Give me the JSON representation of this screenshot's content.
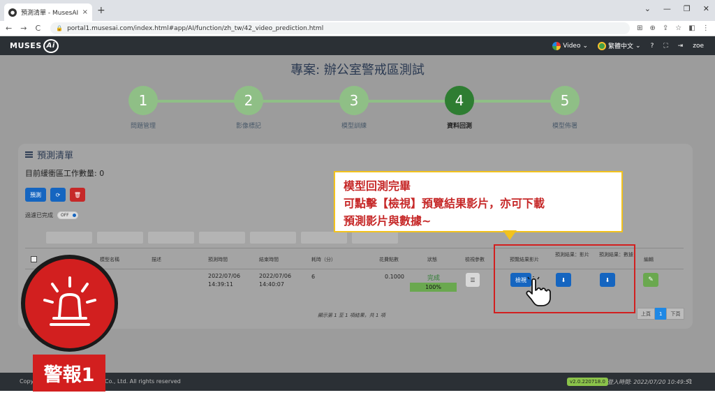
{
  "browser": {
    "tab_title": "預測清單 - MusesAI",
    "tab_close": "×",
    "new_tab": "+",
    "url": "portal1.musesai.com/index.html#app/AI/function/zh_tw/42_video_prediction.html",
    "win_controls": [
      "⌄",
      "—",
      "❐",
      "✕"
    ]
  },
  "header": {
    "logo_text": "MUSES",
    "logo_ai": "Ai",
    "video_label": "Video",
    "lang_label": "繁體中文",
    "user": "zoe"
  },
  "project": {
    "title": "專案: 辦公室警戒區測試"
  },
  "steps": [
    {
      "num": "1",
      "label": "問題管理"
    },
    {
      "num": "2",
      "label": "影像標記"
    },
    {
      "num": "3",
      "label": "模型訓練"
    },
    {
      "num": "4",
      "label": "資料回測"
    },
    {
      "num": "5",
      "label": "模型佈署"
    }
  ],
  "panel": {
    "title": "預測清單",
    "queue_text": "目前緩衝區工作數量: 0",
    "predict_btn": "預測",
    "refresh_icon": "⟳",
    "delete_icon": "🗑",
    "filter_label": "過濾已完成",
    "toggle_text": "OFF"
  },
  "table": {
    "headers": {
      "model_name": "模型名稱",
      "desc": "描述",
      "pred_time": "預測時間",
      "end_time": "結束時間",
      "duration": "耗時（分）",
      "points": "花費點數",
      "status": "狀態",
      "params": "檢視參數",
      "preview": "預覽結果影片",
      "res_video": "預測結果：影片",
      "res_data": "預測結果：數據",
      "edit": "編輯"
    },
    "row": {
      "pred_time_date": "2022/07/06",
      "pred_time_clock": "14:39:11",
      "end_time_date": "2022/07/06",
      "end_time_clock": "14:40:07",
      "duration": "6",
      "points": "0.1000",
      "status": "完成",
      "progress_pct": 100,
      "progress_label": "100%",
      "view_btn": "檢視"
    },
    "info": "顯示第 1 至 1 項結果，共 1 項",
    "pager": {
      "prev": "上頁",
      "current": "1",
      "next": "下頁"
    }
  },
  "footer": {
    "copy_prefix": "Copy",
    "copy_suffix": "Co., Ltd. All rights reserved",
    "version": "v2.0.220718.0",
    "login": "登入時間: 2022/07/20 10:49:51"
  },
  "callout": {
    "lines": [
      "模型回測完畢",
      "可點擊【檢視】預覽結果影片，亦可下載",
      "預測影片與數據~"
    ]
  },
  "alarm": {
    "label": "警報1"
  },
  "colors": {
    "accent_green": "#2e7d32",
    "step_green": "#8fbf86",
    "primary_blue": "#1565c0",
    "alert_red": "#d21f1f",
    "callout_border": "#f2c21d"
  }
}
